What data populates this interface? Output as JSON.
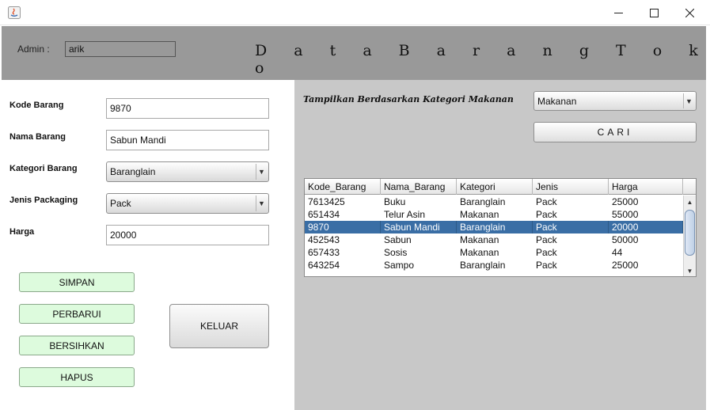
{
  "window": {
    "app_icon": "java-icon",
    "controls": {
      "minimize": "—",
      "maximize": "☐",
      "close": "✕"
    }
  },
  "header": {
    "admin_label": "Admin :",
    "admin_value": "arik",
    "title": "D a t a B a r a n g T o k o"
  },
  "form": {
    "kode_label": "Kode Barang",
    "kode_value": "9870",
    "nama_label": "Nama Barang",
    "nama_value": "Sabun Mandi",
    "kategori_label": "Kategori Barang",
    "kategori_value": "Baranglain",
    "packaging_label": "Jenis Packaging",
    "packaging_value": "Pack",
    "harga_label": "Harga",
    "harga_value": "20000"
  },
  "buttons": {
    "simpan": "SIMPAN",
    "perbarui": "PERBARUI",
    "bersihkan": "BERSIHKAN",
    "hapus": "HAPUS",
    "keluar": "KELUAR",
    "cari": "CARI"
  },
  "filter": {
    "label": "Tampilkan Berdasarkan Kategori Makanan",
    "value": "Makanan"
  },
  "table": {
    "columns": [
      "Kode_Barang",
      "Nama_Barang",
      "Kategori",
      "Jenis",
      "Harga"
    ],
    "rows": [
      [
        "7613425",
        "Buku",
        "Baranglain",
        "Pack",
        "25000"
      ],
      [
        "651434",
        "Telur Asin",
        "Makanan",
        "Pack",
        "55000"
      ],
      [
        "9870",
        "Sabun Mandi",
        "Baranglain",
        "Pack",
        "20000"
      ],
      [
        "452543",
        "Sabun",
        "Makanan",
        "Pack",
        "50000"
      ],
      [
        "657433",
        "Sosis",
        "Makanan",
        "Pack",
        "44"
      ],
      [
        "643254",
        "Sampo",
        "Baranglain",
        "Pack",
        "25000"
      ]
    ],
    "selected_row": 2
  },
  "colors": {
    "header_bg": "#999999",
    "right_panel_bg": "#c8c8c8",
    "selection": "#3a6ea5",
    "action_button": "#ddfbdd"
  }
}
